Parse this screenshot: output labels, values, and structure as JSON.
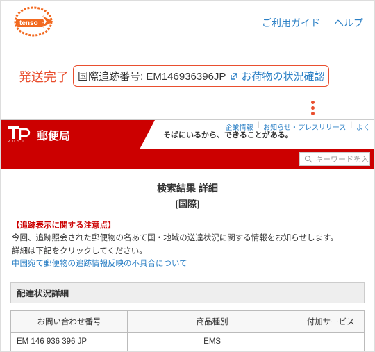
{
  "header": {
    "nav": {
      "guide": "ご利用ガイド",
      "help": "ヘルプ"
    }
  },
  "status": {
    "label": "発送完了",
    "tracking_prefix": "国際追跡番号: ",
    "tracking_number": "EM146936396JP",
    "check_link": "お荷物の状況確認"
  },
  "jp": {
    "brand": "郵便局",
    "tagline": "そばにいるから、できることがある。",
    "toplinks": {
      "corp": "企業情報",
      "press": "お知らせ・プレスリリース",
      "faq": "よく"
    },
    "search_placeholder": "キーワードを入力",
    "result_title": "検索結果 詳細",
    "result_sub": "[国際]",
    "notice_title": "【追跡表示に関する注意点】",
    "notice_body1": "今回、追跡照会された郵便物の名あて国・地域の送達状況に関する情報をお知らせします。",
    "notice_body2": "詳細は下記をクリックしてください。",
    "notice_link": "中国宛て郵便物の追跡情報反映の不具合について",
    "detail_header": "配達状況詳細",
    "table": {
      "headers": {
        "inquiry": "お問い合わせ番号",
        "kind": "商品種別",
        "service": "付加サービス"
      },
      "row": {
        "inquiry": "EM 146 936 396 JP",
        "kind": "EMS",
        "service": ""
      }
    }
  }
}
